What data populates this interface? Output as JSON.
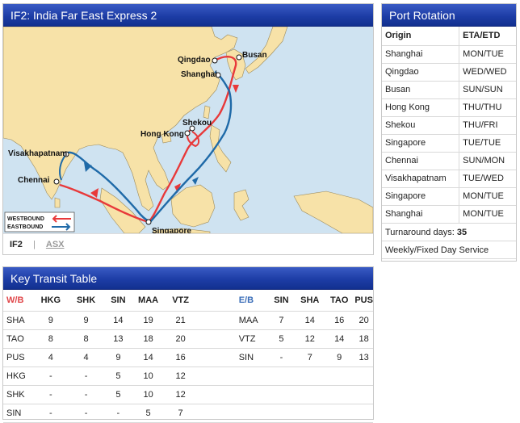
{
  "map_panel": {
    "title": "IF2: India Far East Express 2",
    "tabs": {
      "active": "IF2",
      "separator": "|",
      "link": "ASX"
    },
    "ports": {
      "qingdao": "Qingdao",
      "busan": "Busan",
      "shanghai": "Shanghai",
      "shekou": "Shekou",
      "hongkong": "Hong Kong",
      "visakhapatnam": "Visakhapatnam",
      "chennai": "Chennai",
      "singapore": "Singapore"
    },
    "legend": {
      "westbound": "WESTBOUND",
      "eastbound": "EASTBOUND"
    },
    "colors": {
      "westbound": "#e8393a",
      "eastbound": "#1f6aa8",
      "sea": "#cfe3f1",
      "land": "#f7e2a8"
    }
  },
  "rotation": {
    "title": "Port Rotation",
    "headers": [
      "Origin",
      "ETA/ETD"
    ],
    "rows": [
      [
        "Shanghai",
        "MON/TUE"
      ],
      [
        "Qingdao",
        "WED/WED"
      ],
      [
        "Busan",
        "SUN/SUN"
      ],
      [
        "Hong Kong",
        "THU/THU"
      ],
      [
        "Shekou",
        "THU/FRI"
      ],
      [
        "Singapore",
        "TUE/TUE"
      ],
      [
        "Chennai",
        "SUN/MON"
      ],
      [
        "Visakhapatnam",
        "TUE/WED"
      ],
      [
        "Singapore",
        "MON/TUE"
      ],
      [
        "Shanghai",
        "MON/TUE"
      ]
    ],
    "turnaround_label": "Turnaround days:",
    "turnaround_value": "35",
    "service_note": "Weekly/Fixed Day Service"
  },
  "transit": {
    "title": "Key Transit Table",
    "wb_header": [
      "W/B",
      "HKG",
      "SHK",
      "SIN",
      "MAA",
      "VTZ"
    ],
    "eb_header": [
      "E/B",
      "SIN",
      "SHA",
      "TAO",
      "PUS"
    ],
    "wb_rows": [
      [
        "SHA",
        "9",
        "9",
        "14",
        "19",
        "21"
      ],
      [
        "TAO",
        "8",
        "8",
        "13",
        "18",
        "20"
      ],
      [
        "PUS",
        "4",
        "4",
        "9",
        "14",
        "16"
      ],
      [
        "HKG",
        "-",
        "-",
        "5",
        "10",
        "12"
      ],
      [
        "SHK",
        "-",
        "-",
        "5",
        "10",
        "12"
      ],
      [
        "SIN",
        "-",
        "-",
        "-",
        "5",
        "7"
      ]
    ],
    "eb_rows": [
      [
        "MAA",
        "7",
        "14",
        "16",
        "20"
      ],
      [
        "VTZ",
        "5",
        "12",
        "14",
        "18"
      ],
      [
        "SIN",
        "-",
        "7",
        "9",
        "13"
      ],
      [
        "",
        "",
        "",
        "",
        ""
      ],
      [
        "",
        "",
        "",
        "",
        ""
      ],
      [
        "",
        "",
        "",
        "",
        ""
      ]
    ]
  }
}
